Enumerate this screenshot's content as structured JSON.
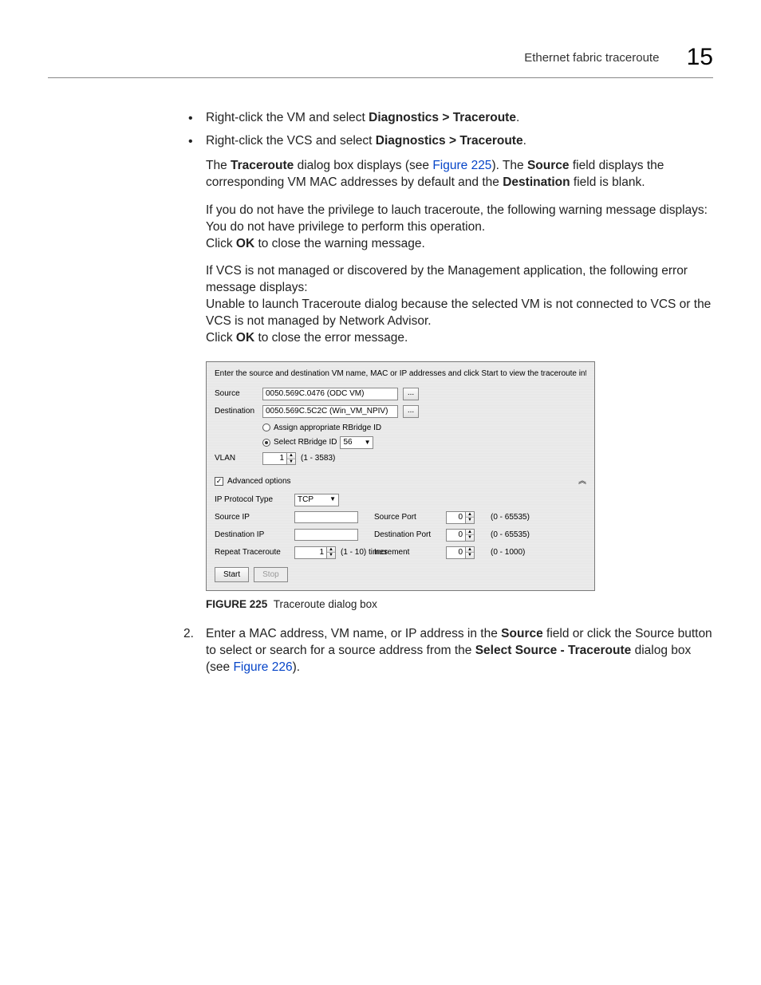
{
  "header": {
    "title": "Ethernet fabric traceroute",
    "section_number": "15"
  },
  "bullets": {
    "b1_pre": "Right-click the VM and select ",
    "b1_bold": "Diagnostics > Traceroute",
    "b2_pre": "Right-click the VCS and select ",
    "b2_bold": "Diagnostics > Traceroute"
  },
  "para1": {
    "t1": "The ",
    "b1": "Traceroute",
    "t2": " dialog box displays (see ",
    "link1": "Figure 225",
    "t3": "). The ",
    "b2": "Source",
    "t4": " field displays the corresponding VM MAC addresses by default and the ",
    "b3": "Destination",
    "t5": " field is blank."
  },
  "para2": {
    "line1": "If you do not have the privilege to lauch traceroute, the following warning message displays:",
    "line2": "You do not have privilege to perform this operation.",
    "line3a": "Click ",
    "line3b": "OK",
    "line3c": " to close the warning message."
  },
  "para3": {
    "line1": "If VCS is not managed or discovered by the Management application, the following error message displays:",
    "line2": "Unable to launch Traceroute dialog because the selected VM is not connected to VCS or the VCS is not managed by Network Advisor.",
    "line3a": "Click ",
    "line3b": "OK",
    "line3c": " to close the error message."
  },
  "dialog": {
    "instruction": "Enter the source and destination VM name, MAC or IP addresses and click Start to view the traceroute information.",
    "labels": {
      "source": "Source",
      "destination": "Destination",
      "vlan": "VLAN",
      "assign_rbridge": "Assign appropriate RBridge ID",
      "select_rbridge": "Select RBridge ID",
      "adv_options": "Advanced options",
      "ip_proto_type": "IP Protocol Type",
      "source_ip": "Source IP",
      "destination_ip": "Destination IP",
      "repeat_trace": "Repeat Traceroute",
      "source_port": "Source Port",
      "destination_port": "Destination Port",
      "increment": "Increment"
    },
    "values": {
      "source": "0050.569C.0476 (ODC VM)",
      "destination": "0050.569C.5C2C (Win_VM_NPIV)",
      "rbridge_id": "56",
      "vlan": "1",
      "vlan_range": "(1 - 3583)",
      "proto": "TCP",
      "repeat": "1",
      "repeat_range": "(1 - 10) times",
      "source_port": "0",
      "dest_port": "0",
      "port_range": "(0 - 65535)",
      "increment": "0",
      "increment_range": "(0 - 1000)",
      "adv_checked": "✓",
      "ellipsis": "..."
    },
    "buttons": {
      "start": "Start",
      "stop": "Stop"
    }
  },
  "figure": {
    "label": "FIGURE 225",
    "caption": "Traceroute dialog box"
  },
  "step2": {
    "num": "2.",
    "t1": "Enter a MAC address, VM name, or IP address in the ",
    "b1": "Source",
    "t2": " field or click the Source button to select or search for a source address from the ",
    "b2": "Select Source - Traceroute",
    "t3": " dialog box (see ",
    "link": "Figure 226",
    "t4": ")."
  }
}
